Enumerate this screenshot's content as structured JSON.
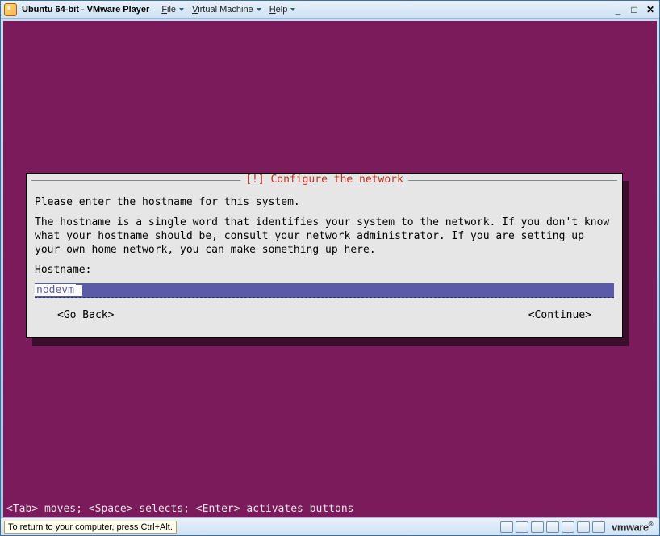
{
  "titlebar": {
    "title": "Ubuntu 64-bit - VMware Player",
    "menus": {
      "file": "File",
      "vm": "Virtual Machine",
      "help": "Help"
    }
  },
  "dialog": {
    "header": "[!] Configure the network",
    "intro": "Please enter the hostname for this system.",
    "explain": "The hostname is a single word that identifies your system to the network. If you don't know what your hostname should be, consult your network administrator. If you are setting up your own home network, you can make something up here.",
    "hostname_label": "Hostname:",
    "hostname_value": "nodevm",
    "go_back": "<Go Back>",
    "continue": "<Continue>"
  },
  "footer_hint": "<Tab> moves; <Space> selects; <Enter> activates buttons",
  "statusbar": {
    "hint": "To return to your computer, press Ctrl+Alt.",
    "brand": "vmware"
  }
}
